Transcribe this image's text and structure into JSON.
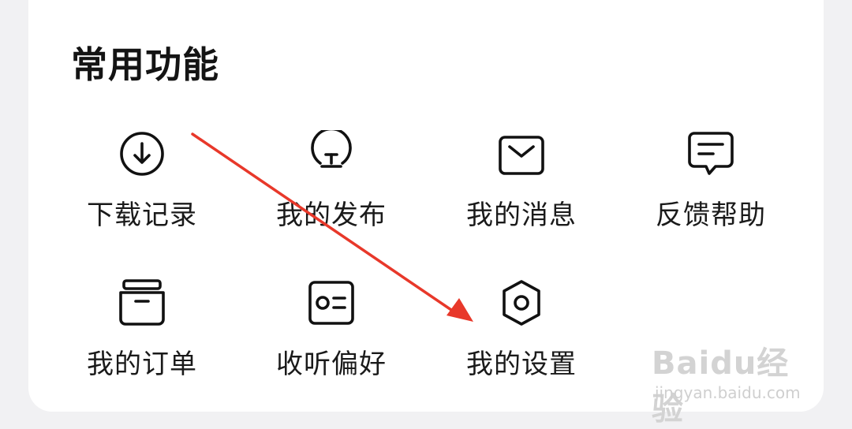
{
  "section": {
    "title": "常用功能"
  },
  "items": [
    {
      "label": "下载记录",
      "icon": "download-icon"
    },
    {
      "label": "我的发布",
      "icon": "lightbulb-icon"
    },
    {
      "label": "我的消息",
      "icon": "mail-icon"
    },
    {
      "label": "反馈帮助",
      "icon": "feedback-icon"
    },
    {
      "label": "我的订单",
      "icon": "order-box-icon"
    },
    {
      "label": "收听偏好",
      "icon": "id-card-icon"
    },
    {
      "label": "我的设置",
      "icon": "settings-hexagon-icon"
    }
  ],
  "annotation": {
    "arrow_color": "#e8382a"
  },
  "watermark": {
    "brand": "Baidu经验",
    "url": "jingyan.baidu.com"
  }
}
